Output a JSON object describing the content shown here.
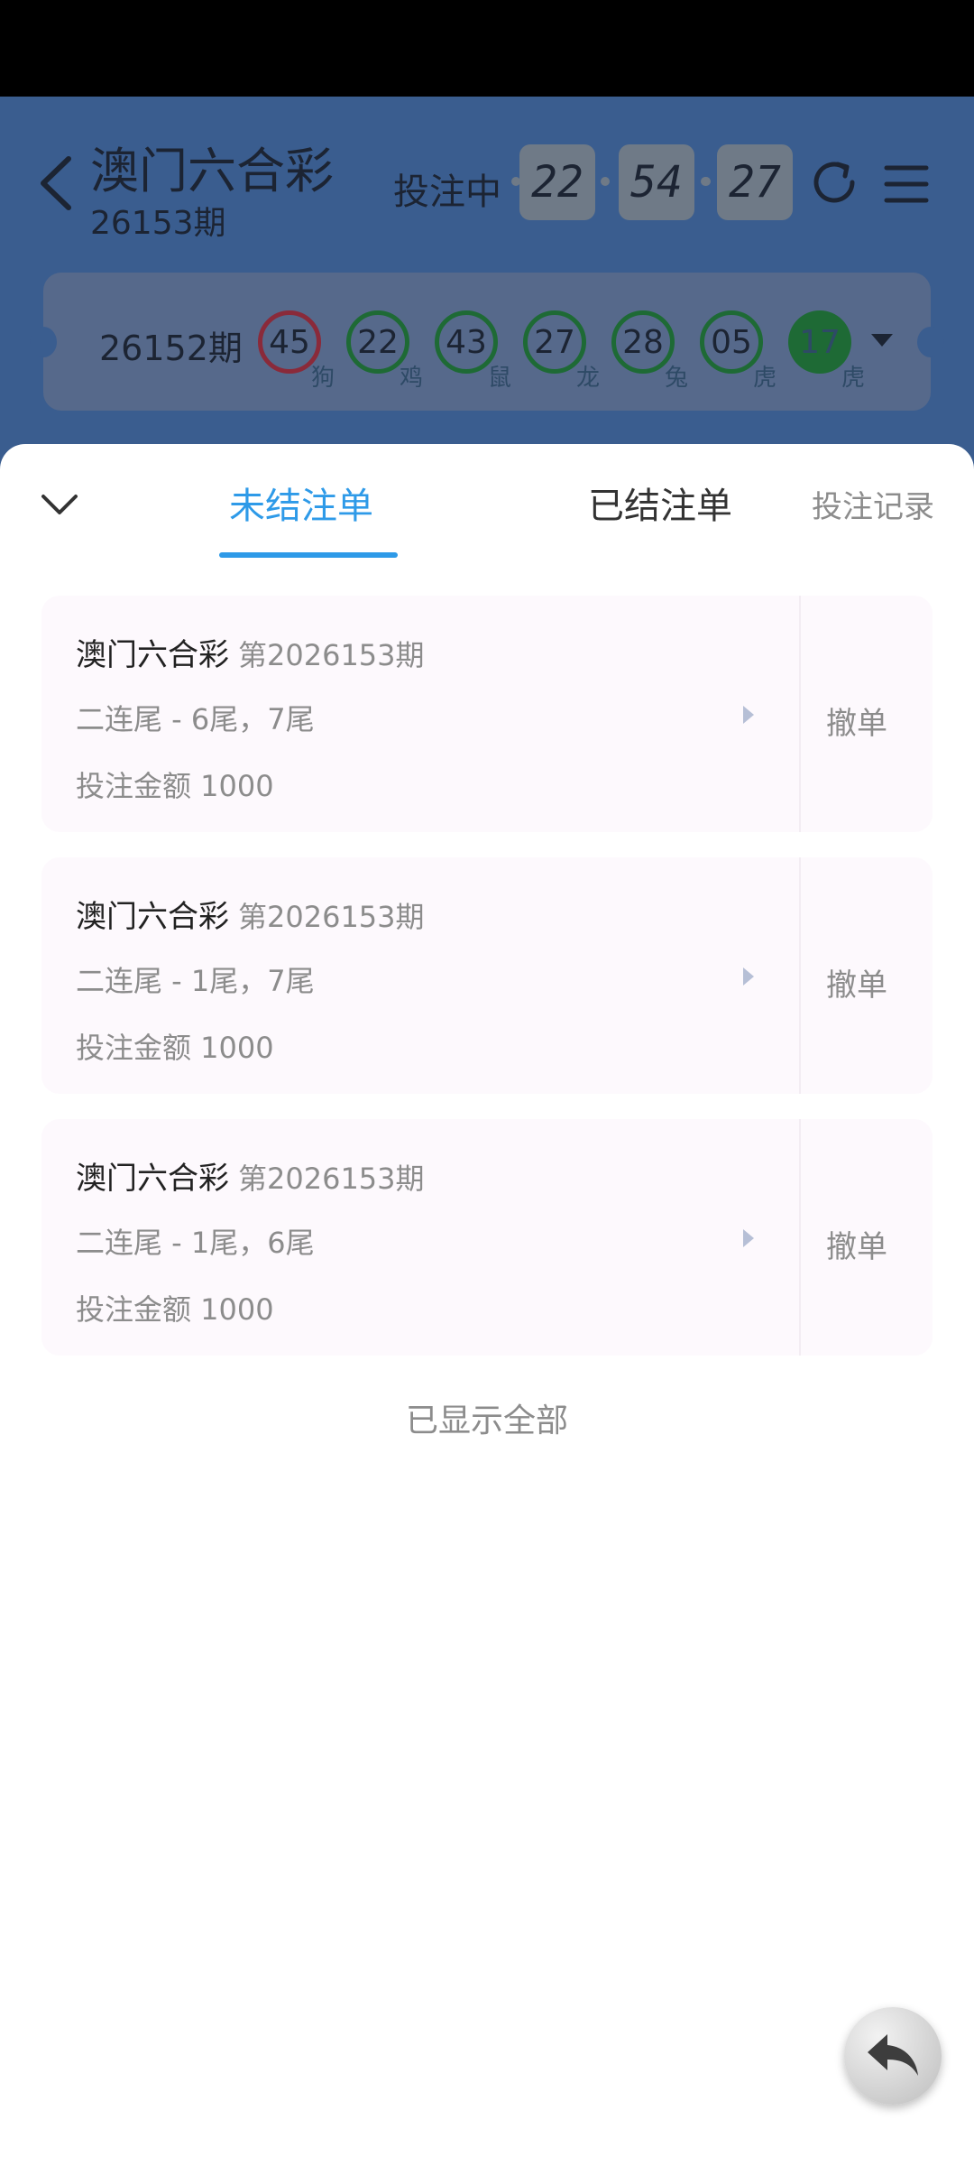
{
  "header": {
    "title": "澳门六合彩",
    "issue": "26153期",
    "bet_status": "投注中",
    "timer": {
      "h": "22",
      "m": "54",
      "s": "27"
    }
  },
  "last_draw": {
    "issue": "26152期",
    "balls": [
      {
        "num": "45",
        "zodiac": "狗",
        "color": "red"
      },
      {
        "num": "22",
        "zodiac": "鸡",
        "color": "green"
      },
      {
        "num": "43",
        "zodiac": "鼠",
        "color": "green"
      },
      {
        "num": "27",
        "zodiac": "龙",
        "color": "green"
      },
      {
        "num": "28",
        "zodiac": "兔",
        "color": "green"
      },
      {
        "num": "05",
        "zodiac": "虎",
        "color": "green"
      },
      {
        "num": "17",
        "zodiac": "虎",
        "color": "green"
      }
    ]
  },
  "tabs": {
    "active": "未结注单",
    "settled": "已结注单",
    "record": "投注记录"
  },
  "orders": [
    {
      "game": "澳门六合彩",
      "issue": "第2026153期",
      "desc": "二连尾 - 6尾，7尾",
      "amount": "投注金额 1000",
      "cancel": "撤单"
    },
    {
      "game": "澳门六合彩",
      "issue": "第2026153期",
      "desc": "二连尾 - 1尾，7尾",
      "amount": "投注金额 1000",
      "cancel": "撤单"
    },
    {
      "game": "澳门六合彩",
      "issue": "第2026153期",
      "desc": "二连尾 - 1尾，6尾",
      "amount": "投注金额 1000",
      "cancel": "撤单"
    }
  ],
  "list_end": "已显示全部",
  "colors": {
    "accent": "#2e9ae8",
    "overlay_bg": "#3a5d8f"
  }
}
